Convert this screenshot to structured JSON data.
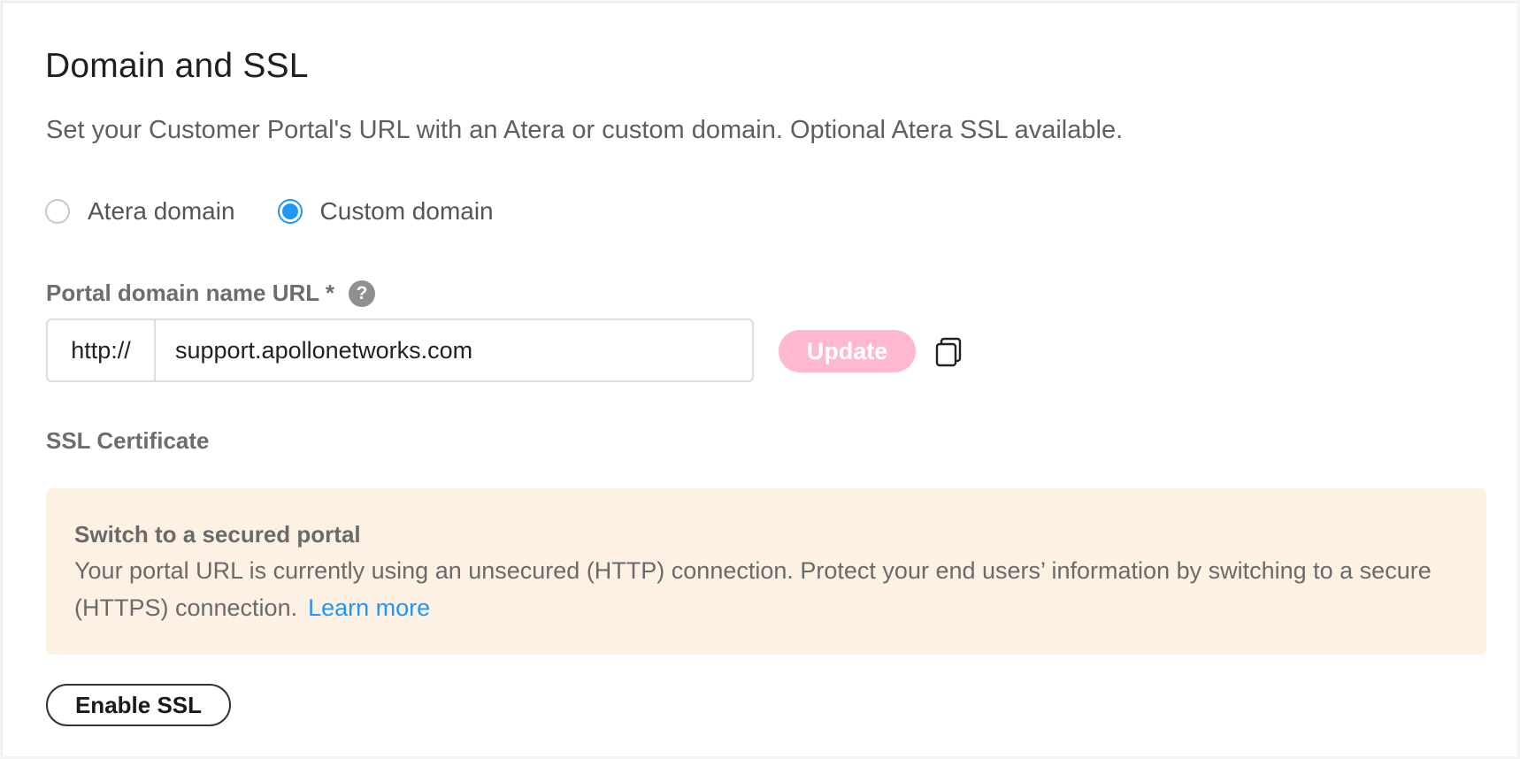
{
  "section": {
    "title": "Domain and SSL",
    "subtitle": "Set your Customer Portal's URL with an Atera or custom domain. Optional Atera SSL available."
  },
  "domain_type": {
    "options": [
      {
        "label": "Atera domain",
        "checked": false
      },
      {
        "label": "Custom domain",
        "checked": true
      }
    ]
  },
  "portal_url": {
    "label": "Portal domain name URL *",
    "help_icon": "?",
    "prefix": "http://",
    "value": "support.apollonetworks.com",
    "update_label": "Update",
    "copy_icon": "copy-icon"
  },
  "ssl": {
    "label": "SSL Certificate",
    "notice_title": "Switch to a secured portal",
    "notice_body": "Your portal URL is currently using an unsecured (HTTP) connection. Protect your end users’ information by switching to a secure (HTTPS) connection.",
    "learn_more": "Learn more",
    "enable_label": "Enable SSL"
  },
  "colors": {
    "accent": "#2196f3",
    "update_button": "#ffb8d0",
    "notice_background": "#fdf1e3"
  }
}
